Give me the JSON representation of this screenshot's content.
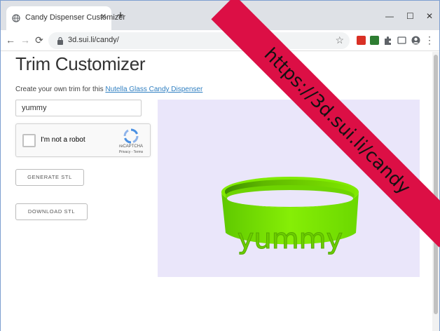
{
  "browser": {
    "tab_title": "Candy Dispenser Customizer",
    "tab_close": "✕",
    "new_tab": "+",
    "url": "3d.sui.li/candy/",
    "back": "←",
    "forward": "→",
    "reload": "⟳",
    "star": "☆",
    "minimize": "—",
    "maximize": "☐",
    "close": "✕",
    "more": "⋮"
  },
  "page": {
    "title": "Trim Customizer",
    "subtitle_prefix": "Create your own trim for this ",
    "subtitle_link": "Nutella Glass Candy Dispenser",
    "input_value": "yummy",
    "captcha": {
      "label": "I'm not a robot",
      "brand": "reCAPTCHA",
      "links": "Privacy - Terms"
    },
    "generate_button": "GENERATE STL",
    "download_button": "DOWNLOAD STL",
    "model_text": "yummy"
  },
  "ribbon": {
    "text": "https://3d.sui.li/candy"
  },
  "colors": {
    "ribbon": "#dc0f45",
    "model": "#7fe800",
    "viewer_bg": "#eae6fa",
    "link": "#2f7fc1"
  }
}
